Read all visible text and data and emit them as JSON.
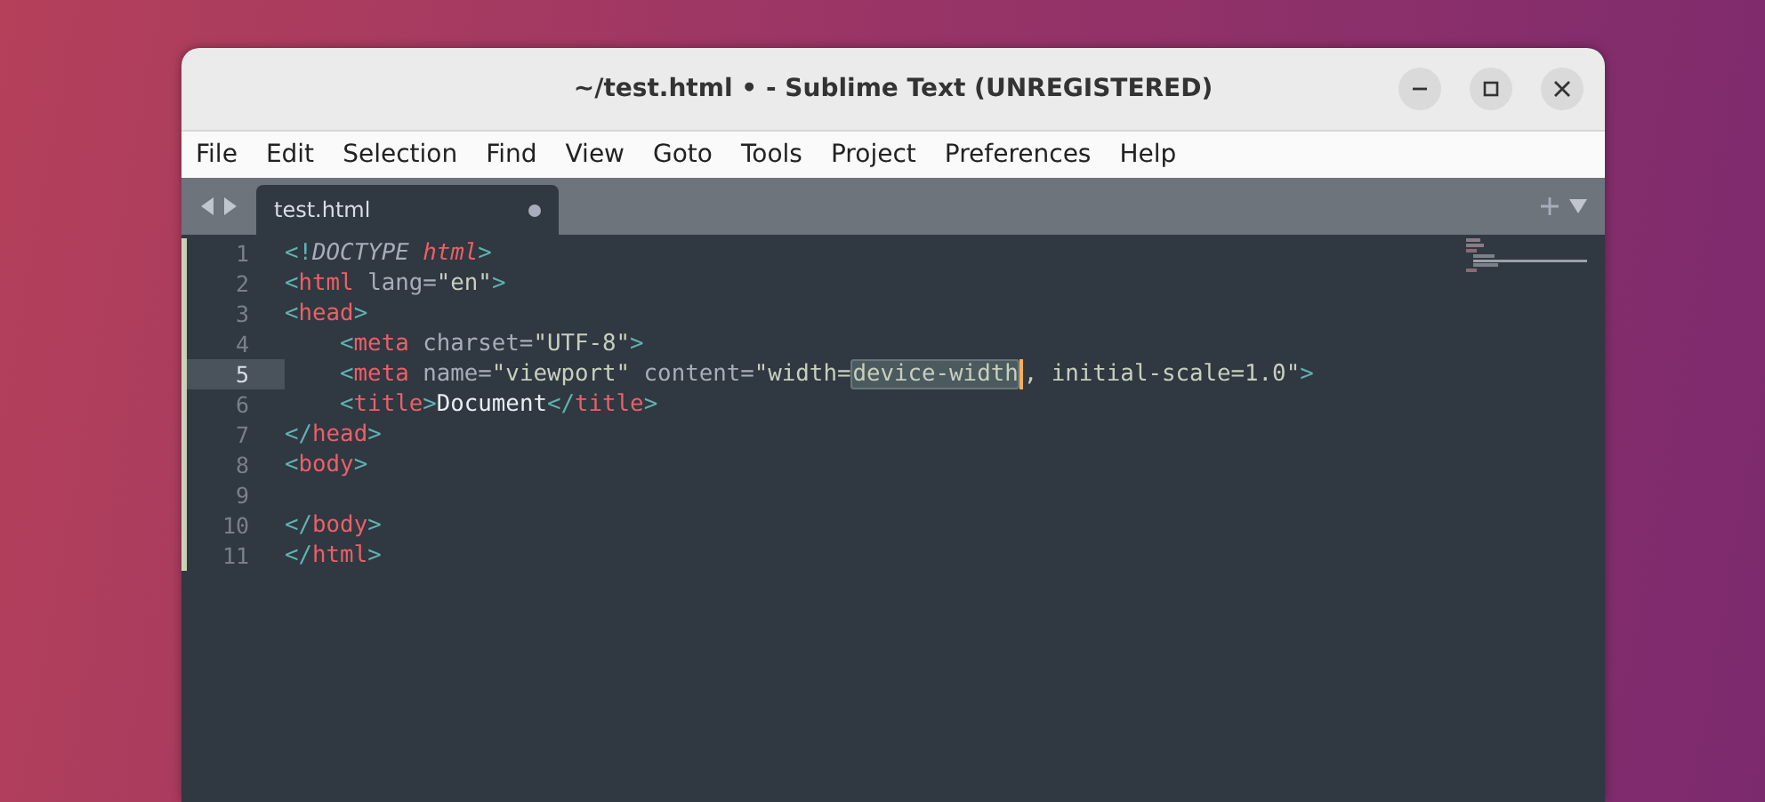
{
  "window": {
    "title": "~/test.html • - Sublime Text (UNREGISTERED)"
  },
  "menu": [
    "File",
    "Edit",
    "Selection",
    "Find",
    "View",
    "Goto",
    "Tools",
    "Project",
    "Preferences",
    "Help"
  ],
  "tabs": [
    {
      "label": "test.html",
      "selected": true,
      "modified": true
    }
  ],
  "lines": [
    {
      "number": "1",
      "current": false,
      "tokens": [
        {
          "kind": "punct",
          "text": "<!"
        },
        {
          "kind": "doctype",
          "text": "DOCTYPE "
        },
        {
          "kind": "doctag",
          "text": "html"
        },
        {
          "kind": "punct",
          "text": ">"
        }
      ]
    },
    {
      "number": "2",
      "current": false,
      "tokens": [
        {
          "kind": "punct",
          "text": "<"
        },
        {
          "kind": "tag",
          "text": "html"
        },
        {
          "kind": "attr",
          "text": " lang="
        },
        {
          "kind": "string",
          "text": "\"en\""
        },
        {
          "kind": "punct",
          "text": ">"
        }
      ]
    },
    {
      "number": "3",
      "current": false,
      "tokens": [
        {
          "kind": "punct",
          "text": "<"
        },
        {
          "kind": "tag",
          "text": "head"
        },
        {
          "kind": "punct",
          "text": ">"
        }
      ]
    },
    {
      "number": "4",
      "current": false,
      "indented": true,
      "tokens": [
        {
          "kind": "punct",
          "text": "<"
        },
        {
          "kind": "tag",
          "text": "meta"
        },
        {
          "kind": "attr",
          "text": " charset="
        },
        {
          "kind": "string",
          "text": "\"UTF-8\""
        },
        {
          "kind": "punct",
          "text": ">"
        }
      ]
    },
    {
      "number": "5",
      "current": true,
      "indented": true,
      "tokens": [
        {
          "kind": "punct",
          "text": "<"
        },
        {
          "kind": "tag",
          "text": "meta"
        },
        {
          "kind": "attr",
          "text": " name="
        },
        {
          "kind": "string",
          "text": "\"viewport\""
        },
        {
          "kind": "attr",
          "text": " content="
        },
        {
          "kind": "string",
          "text": "\"width="
        },
        {
          "kind": "selection",
          "text": "device-width"
        },
        {
          "kind": "string",
          "text": ", initial-scale=1.0\""
        },
        {
          "kind": "punct",
          "text": ">"
        }
      ]
    },
    {
      "number": "6",
      "current": false,
      "indented": true,
      "tokens": [
        {
          "kind": "punct",
          "text": "<"
        },
        {
          "kind": "tag",
          "text": "title"
        },
        {
          "kind": "punct",
          "text": ">"
        },
        {
          "kind": "text",
          "text": "Document"
        },
        {
          "kind": "punct",
          "text": "</"
        },
        {
          "kind": "tag",
          "text": "title"
        },
        {
          "kind": "punct",
          "text": ">"
        }
      ]
    },
    {
      "number": "7",
      "current": false,
      "tokens": [
        {
          "kind": "punct",
          "text": "</"
        },
        {
          "kind": "tag",
          "text": "head"
        },
        {
          "kind": "punct",
          "text": ">"
        }
      ]
    },
    {
      "number": "8",
      "current": false,
      "tokens": [
        {
          "kind": "punct",
          "text": "<"
        },
        {
          "kind": "tag",
          "text": "body"
        },
        {
          "kind": "punct",
          "text": ">"
        }
      ]
    },
    {
      "number": "9",
      "current": false
    },
    {
      "number": "10",
      "current": false,
      "tokens": [
        {
          "kind": "punct",
          "text": "</"
        },
        {
          "kind": "tag",
          "text": "body"
        },
        {
          "kind": "punct",
          "text": ">"
        }
      ]
    },
    {
      "number": "11",
      "current": false,
      "tokens": [
        {
          "kind": "punct",
          "text": "</"
        },
        {
          "kind": "tag",
          "text": "html"
        },
        {
          "kind": "punct",
          "text": ">"
        }
      ]
    }
  ]
}
